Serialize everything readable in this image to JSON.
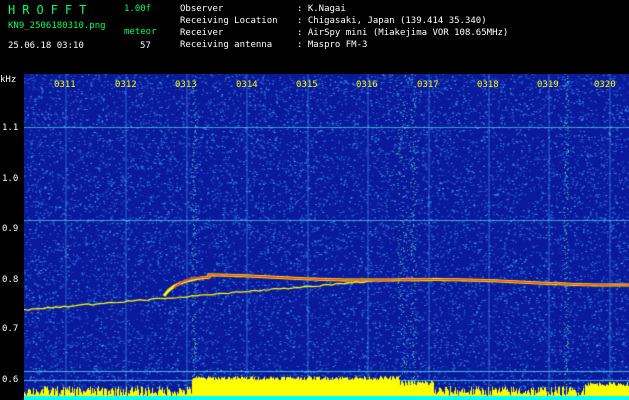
{
  "header": {
    "app_title": "HROFFT",
    "version": "1.00f",
    "filename": "KN9_2506180310.png",
    "meteor_label": "meteor",
    "meteor_count": "57",
    "datetime": "25.06.18 03:10"
  },
  "info": [
    {
      "label": "Observer",
      "value": ": K.Nagai"
    },
    {
      "label": "Receiving Location",
      "value": ": Chigasaki, Japan (139.414 35.340)"
    },
    {
      "label": "Receiver",
      "value": ": AirSpy mini (Miakejima VOR 108.65MHz)"
    },
    {
      "label": "Receiving antenna",
      "value": ": Maspro FM-3"
    }
  ],
  "axis": {
    "y_unit": "kHz",
    "y_ticks": [
      "1.1",
      "1.0",
      "0.9",
      "0.8",
      "0.7",
      "0.6"
    ],
    "x_ticks": [
      "0311",
      "0312",
      "0313",
      "0314",
      "0315",
      "0316",
      "0317",
      "0318",
      "0319",
      "0320"
    ]
  },
  "colors": {
    "background": "#0a1a9c",
    "noise": "#2f6fe0",
    "hot": "#ff3a2a",
    "trace": "#ffff00",
    "level": "#ffff00",
    "baseline": "#00ffff",
    "label_green": "#00ff66"
  }
}
